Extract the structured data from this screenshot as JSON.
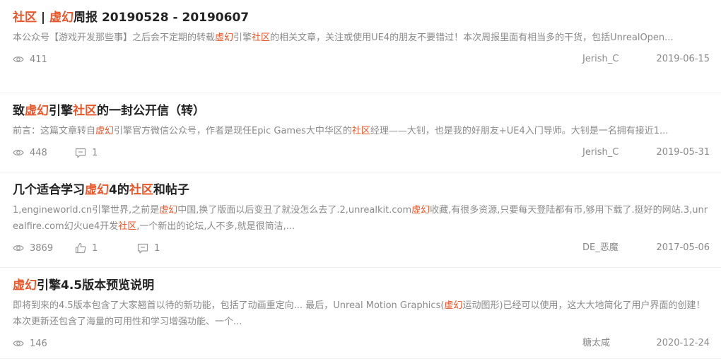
{
  "articles": [
    {
      "title": [
        {
          "t": "社区",
          "hl": true
        },
        {
          "t": " | ",
          "hl": false
        },
        {
          "t": "虚幻",
          "hl": true
        },
        {
          "t": "周报 20190528 - 20190607",
          "hl": false
        }
      ],
      "desc": [
        {
          "t": "本公众号【游戏开发那些事】之后会不定期的转载",
          "hl": false
        },
        {
          "t": "虚幻",
          "hl": true
        },
        {
          "t": "引擎",
          "hl": false
        },
        {
          "t": "社区",
          "hl": true
        },
        {
          "t": "的相关文章，关注或使用UE4的朋友不要错过！本次周报里面有相当多的干货，包括UnrealOpen...",
          "hl": false
        }
      ],
      "views": "411",
      "likes": "",
      "comments": "",
      "author": "Jerish_C",
      "date": "2019-06-15",
      "height": 132
    },
    {
      "title": [
        {
          "t": "致",
          "hl": false
        },
        {
          "t": "虚幻",
          "hl": true
        },
        {
          "t": "引擎",
          "hl": false
        },
        {
          "t": "社区",
          "hl": true
        },
        {
          "t": "的一封公开信（转）",
          "hl": false
        }
      ],
      "desc": [
        {
          "t": "前言：这篇文章转自",
          "hl": false
        },
        {
          "t": "虚幻",
          "hl": true
        },
        {
          "t": "引擎官方微信公众号，作者是现任Epic Games大中华区的",
          "hl": false
        },
        {
          "t": "社区",
          "hl": true
        },
        {
          "t": "经理——大钊，也是我的好朋友+UE4入门导师。大钊是一名拥有接近1...",
          "hl": false
        }
      ],
      "views": "448",
      "likes": "",
      "comments": "1",
      "author": "Jerish_C",
      "date": "2019-05-31",
      "height": 112
    },
    {
      "title": [
        {
          "t": "几个适合学习",
          "hl": false
        },
        {
          "t": "虚幻",
          "hl": true
        },
        {
          "t": "4的",
          "hl": false
        },
        {
          "t": "社区",
          "hl": true
        },
        {
          "t": "和帖子",
          "hl": false
        }
      ],
      "desc": [
        {
          "t": "1,engineworld.cn引擎世界,之前是",
          "hl": false
        },
        {
          "t": "虚幻",
          "hl": true
        },
        {
          "t": "中国,换了版面以后变丑了就没怎么去了.2,unrealkit.com",
          "hl": false
        },
        {
          "t": "虚幻",
          "hl": true
        },
        {
          "t": "收藏,有很多资源,只要每天登陆都有币,够用下载了.挺好的网站.3,unrealfire.com幻火ue4开发",
          "hl": false
        },
        {
          "t": "社区",
          "hl": true
        },
        {
          "t": ",一个新出的论坛,人不多,就是很简洁,...",
          "hl": false
        }
      ],
      "views": "3869",
      "likes": "1",
      "comments": "1",
      "author": "DE_恶魔",
      "date": "2017-05-06",
      "height": 135
    },
    {
      "title": [
        {
          "t": "虚幻",
          "hl": true
        },
        {
          "t": "引擎4.5版本预览说明",
          "hl": false
        }
      ],
      "desc": [
        {
          "t": "即将到来的4.5版本包含了大家翘首以待的新功能，包括了动画重定向... 最后，Unreal Motion Graphics(",
          "hl": false
        },
        {
          "t": "虚幻",
          "hl": true
        },
        {
          "t": "运动图形)已经可以使用，这大大地简化了用户界面的创建！本次更新还包含了海量的可用性和学习增强功能、一个...",
          "hl": false
        }
      ],
      "views": "146",
      "likes": "",
      "comments": "",
      "author": "糖太咸",
      "date": "2020-12-24",
      "height": 129
    }
  ],
  "colors": {
    "highlight": "#e8562a",
    "meta": "#8a8a8a"
  }
}
